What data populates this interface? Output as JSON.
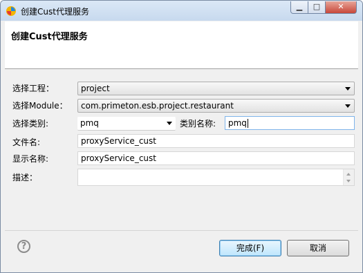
{
  "window": {
    "title": "创建Cust代理服务",
    "min_icon": "minimize-icon",
    "max_icon": "maximize-icon",
    "close_icon": "close-icon"
  },
  "header": {
    "title": "创建Cust代理服务"
  },
  "form": {
    "project": {
      "label": "选择工程：",
      "value": "project"
    },
    "module": {
      "label": "选择Module：",
      "value": "com.primeton.esb.project.restaurant"
    },
    "category": {
      "label": "选择类别:",
      "value": "pmq"
    },
    "category_name": {
      "label": "类别名称:",
      "value": "pmq"
    },
    "file_name": {
      "label": "文件名:",
      "value": "proxyService_cust"
    },
    "display_name": {
      "label": "显示名称:",
      "value": "proxyService_cust"
    },
    "description": {
      "label": "描述：",
      "value": ""
    }
  },
  "footer": {
    "help_symbol": "?",
    "finish_label": "完成(F)",
    "cancel_label": "取消"
  },
  "colors": {
    "default_button": "#bee6fd",
    "close_button": "#c7473a"
  }
}
